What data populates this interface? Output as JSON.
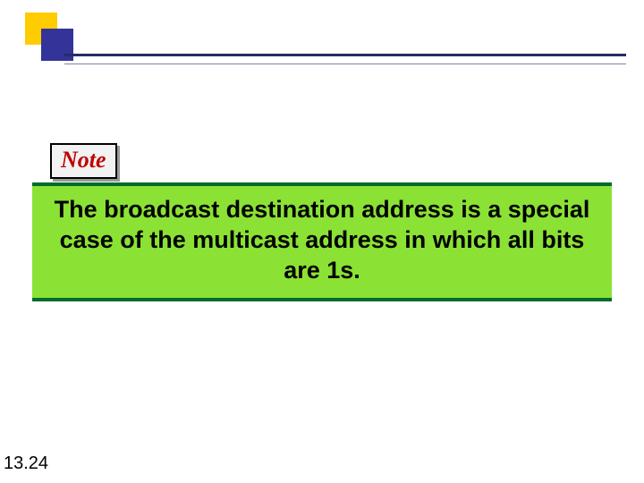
{
  "note_label": "Note",
  "note_body": "The broadcast destination address is a special case of the multicast address in which all bits are 1s.",
  "page_number": "13.24",
  "colors": {
    "accent_yellow": "#ffcc00",
    "accent_blue": "#333399",
    "rule": "#2a2a6a",
    "note_label_text": "#c00000",
    "note_bg": "#8be234",
    "note_border": "#006b2d"
  }
}
